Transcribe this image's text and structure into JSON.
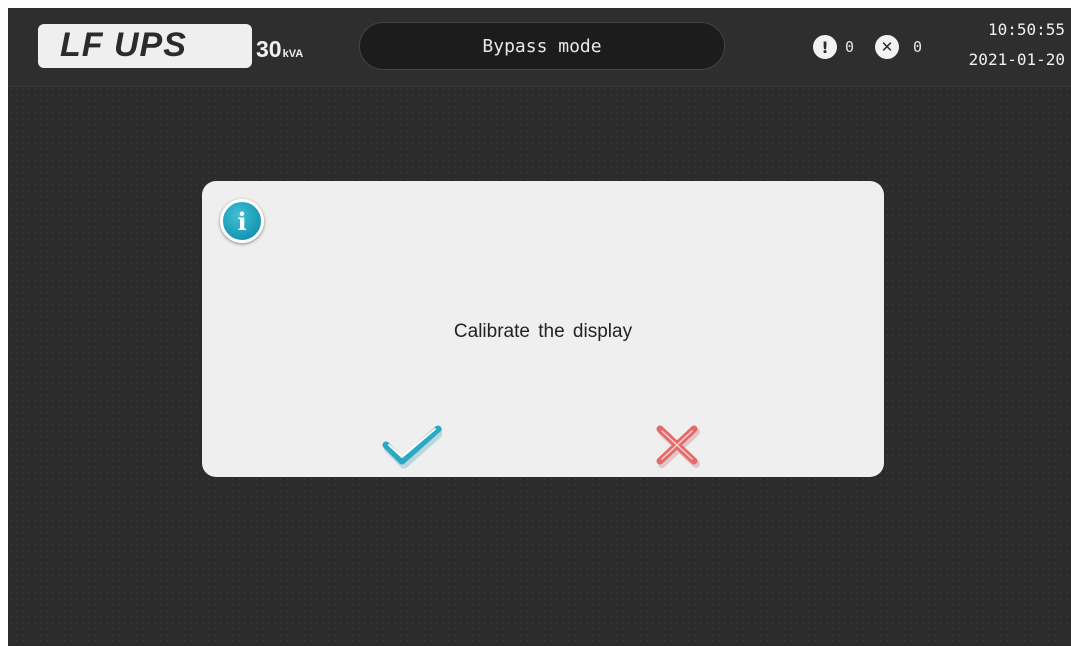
{
  "header": {
    "logo": "LF UPS",
    "rating_value": "30",
    "rating_unit": "kVA",
    "mode": "Bypass mode",
    "alarm_count": "0",
    "fault_count": "0",
    "time": "10:50:55",
    "date": "2021-01-20"
  },
  "icons": {
    "alarm": "exclamation-circle-icon",
    "fault": "x-circle-icon",
    "info": "info-icon",
    "confirm": "checkmark-icon",
    "cancel": "cross-icon"
  },
  "dialog": {
    "message": "Calibrate the display"
  },
  "colors": {
    "background": "#2b2b2b",
    "topbar": "#2e2e2e",
    "dialog": "#efefef",
    "accent_teal": "#1a9ab5",
    "confirm": "#2aa9c2",
    "cancel": "#e46a6a"
  }
}
